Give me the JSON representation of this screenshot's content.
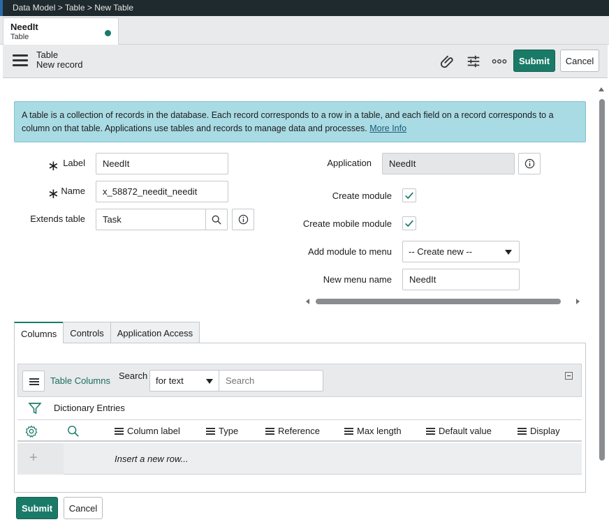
{
  "breadcrumb": "Data Model > Table > New Table",
  "record_tab": {
    "title": "NeedIt",
    "subtitle": "Table"
  },
  "header": {
    "title": "Table",
    "subtitle": "New record",
    "submit_label": "Submit",
    "cancel_label": "Cancel",
    "icons": [
      "paperclip-icon",
      "sliders-icon",
      "more-icon"
    ]
  },
  "info": {
    "text": "A table is a collection of records in the database. Each record corresponds to a row in a table, and each field on a record corresponds to a column on that table. Applications use tables and records to manage data and processes.",
    "link": "More Info"
  },
  "form": {
    "label": {
      "label": "Label",
      "value": "NeedIt"
    },
    "name": {
      "label": "Name",
      "value": "x_58872_needit_needit"
    },
    "extends": {
      "label": "Extends table",
      "value": "Task"
    },
    "application": {
      "label": "Application",
      "value": "NeedIt"
    },
    "create_module": {
      "label": "Create module",
      "checked": true
    },
    "create_mobile_module": {
      "label": "Create mobile module",
      "checked": true
    },
    "add_module_to_menu": {
      "label": "Add module to menu",
      "value": "-- Create new --"
    },
    "new_menu_name": {
      "label": "New menu name",
      "value": "NeedIt"
    }
  },
  "related_tabs": [
    "Columns",
    "Controls",
    "Application Access"
  ],
  "list": {
    "title": "Table Columns",
    "search_label": "Search",
    "search_field": "for text",
    "search_placeholder": "Search",
    "filter_label": "Dictionary Entries",
    "columns": [
      "Column label",
      "Type",
      "Reference",
      "Max length",
      "Default value",
      "Display"
    ],
    "insert_row": "Insert a new row..."
  },
  "footer": {
    "submit_label": "Submit",
    "cancel_label": "Cancel"
  },
  "colors": {
    "accent": "#1a7a68",
    "info_bg": "#a9dbe4",
    "header_bg": "#e8eaec"
  }
}
